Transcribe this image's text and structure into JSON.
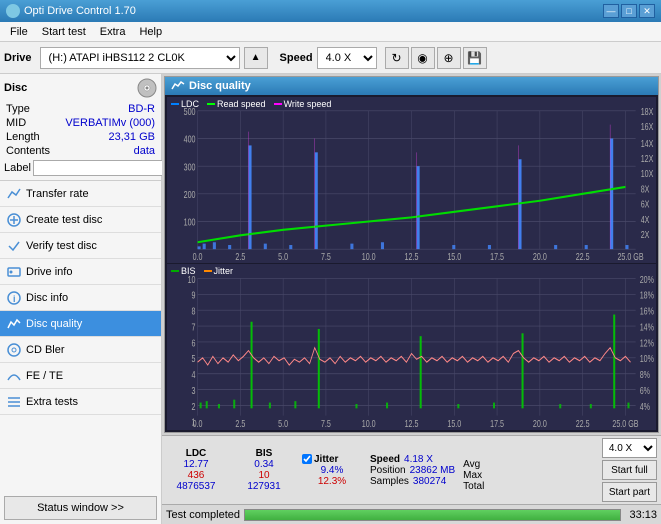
{
  "app": {
    "title": "Opti Drive Control 1.70",
    "icon": "disc-icon"
  },
  "titlebar": {
    "minimize": "—",
    "maximize": "□",
    "close": "✕"
  },
  "menubar": {
    "items": [
      "File",
      "Start test",
      "Extra",
      "Help"
    ]
  },
  "toolbar": {
    "drive_label": "Drive",
    "drive_value": "(H:) ATAPI iHBS112  2 CL0K",
    "speed_label": "Speed",
    "speed_value": "4.0 X"
  },
  "disc": {
    "title": "Disc",
    "type_label": "Type",
    "type_value": "BD-R",
    "mid_label": "MID",
    "mid_value": "VERBATIMv (000)",
    "length_label": "Length",
    "length_value": "23,31 GB",
    "contents_label": "Contents",
    "contents_value": "data",
    "label_label": "Label",
    "label_placeholder": ""
  },
  "nav": {
    "items": [
      {
        "id": "transfer-rate",
        "label": "Transfer rate",
        "active": false
      },
      {
        "id": "create-test-disc",
        "label": "Create test disc",
        "active": false
      },
      {
        "id": "verify-test-disc",
        "label": "Verify test disc",
        "active": false
      },
      {
        "id": "drive-info",
        "label": "Drive info",
        "active": false
      },
      {
        "id": "disc-info",
        "label": "Disc info",
        "active": false
      },
      {
        "id": "disc-quality",
        "label": "Disc quality",
        "active": true
      },
      {
        "id": "cd-bler",
        "label": "CD Bler",
        "active": false
      },
      {
        "id": "fe-te",
        "label": "FE / TE",
        "active": false
      },
      {
        "id": "extra-tests",
        "label": "Extra tests",
        "active": false
      }
    ],
    "status_window": "Status window >>"
  },
  "quality_panel": {
    "title": "Disc quality",
    "title_icon": "disc-quality-icon",
    "legend": {
      "ldc": "LDC",
      "read_speed": "Read speed",
      "write_speed": "Write speed"
    },
    "legend2": {
      "bis": "BIS",
      "jitter": "Jitter"
    },
    "chart1": {
      "y_max": 500,
      "y_labels": [
        "500",
        "400",
        "300",
        "200",
        "100"
      ],
      "y_right": [
        "18X",
        "16X",
        "14X",
        "12X",
        "10X",
        "8X",
        "6X",
        "4X",
        "2X"
      ],
      "x_labels": [
        "0.0",
        "2.5",
        "5.0",
        "7.5",
        "10.0",
        "12.5",
        "15.0",
        "17.5",
        "20.0",
        "22.5",
        "25.0 GB"
      ]
    },
    "chart2": {
      "y_max": 10,
      "y_labels": [
        "10",
        "9",
        "8",
        "7",
        "6",
        "5",
        "4",
        "3",
        "2",
        "1"
      ],
      "y_right": [
        "20%",
        "18%",
        "16%",
        "14%",
        "12%",
        "10%",
        "8%",
        "6%",
        "4%"
      ],
      "x_labels": [
        "0.0",
        "2.5",
        "5.0",
        "7.5",
        "10.0",
        "12.5",
        "15.0",
        "17.5",
        "20.0",
        "22.5",
        "25.0 GB"
      ]
    }
  },
  "stats": {
    "ldc_label": "LDC",
    "bis_label": "BIS",
    "jitter_label": "Jitter",
    "speed_label": "Speed",
    "avg_label": "Avg",
    "max_label": "Max",
    "total_label": "Total",
    "ldc_avg": "12.77",
    "ldc_max": "436",
    "ldc_total": "4876537",
    "bis_avg": "0.34",
    "bis_max": "10",
    "bis_total": "127931",
    "jitter_avg": "9.4%",
    "jitter_max": "12.3%",
    "jitter_checked": true,
    "speed_value": "4.18 X",
    "position_label": "Position",
    "position_value": "23862 MB",
    "samples_label": "Samples",
    "samples_value": "380274",
    "speed_select": "4.0 X",
    "start_full": "Start full",
    "start_part": "Start part"
  },
  "statusbar": {
    "text": "Test completed",
    "progress": 100,
    "time": "33:13"
  }
}
